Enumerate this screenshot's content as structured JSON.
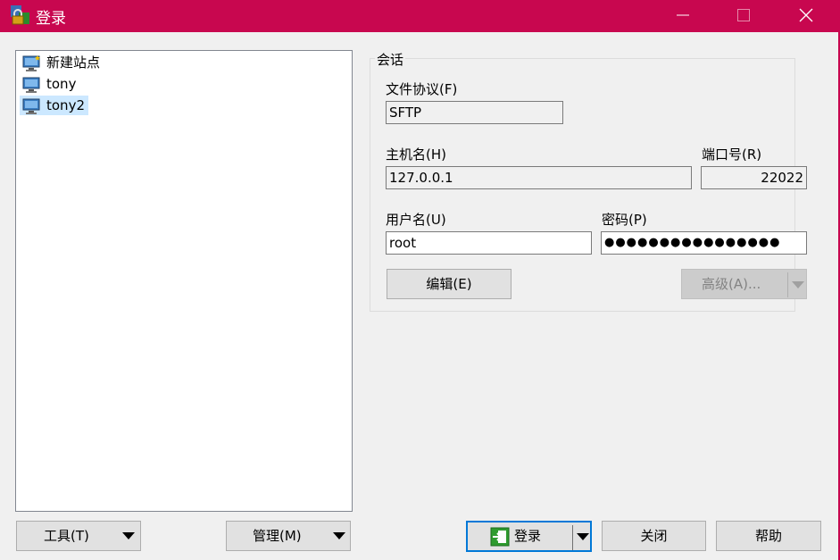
{
  "window": {
    "title": "登录",
    "icon": "winscp-icon"
  },
  "title_buttons": {
    "minimize": "minimize-icon",
    "maximize": "maximize-icon",
    "close": "close-icon"
  },
  "site_tree": {
    "items": [
      {
        "label": "新建站点",
        "icon": "new-site-icon",
        "selected": false
      },
      {
        "label": "tony",
        "icon": "monitor-icon",
        "selected": false
      },
      {
        "label": "tony2",
        "icon": "monitor-icon",
        "selected": true
      }
    ]
  },
  "left_buttons": {
    "tools": "工具(T)",
    "manage": "管理(M)"
  },
  "session": {
    "group_label": "会话",
    "protocol_label": "文件协议(F)",
    "protocol_value": "SFTP",
    "host_label": "主机名(H)",
    "host_value": "127.0.0.1",
    "port_label": "端口号(R)",
    "port_value": "22022",
    "user_label": "用户名(U)",
    "user_value": "root",
    "password_label": "密码(P)",
    "password_value": "●●●●●●●●●●●●●●●●",
    "edit_button": "编辑(E)",
    "advanced_button": "高级(A)..."
  },
  "bottom_buttons": {
    "login": "登录",
    "close": "关闭",
    "help": "帮助"
  },
  "colors": {
    "titlebar": "#c8074f",
    "selection": "#cce8ff",
    "focus_border": "#0078d7"
  }
}
